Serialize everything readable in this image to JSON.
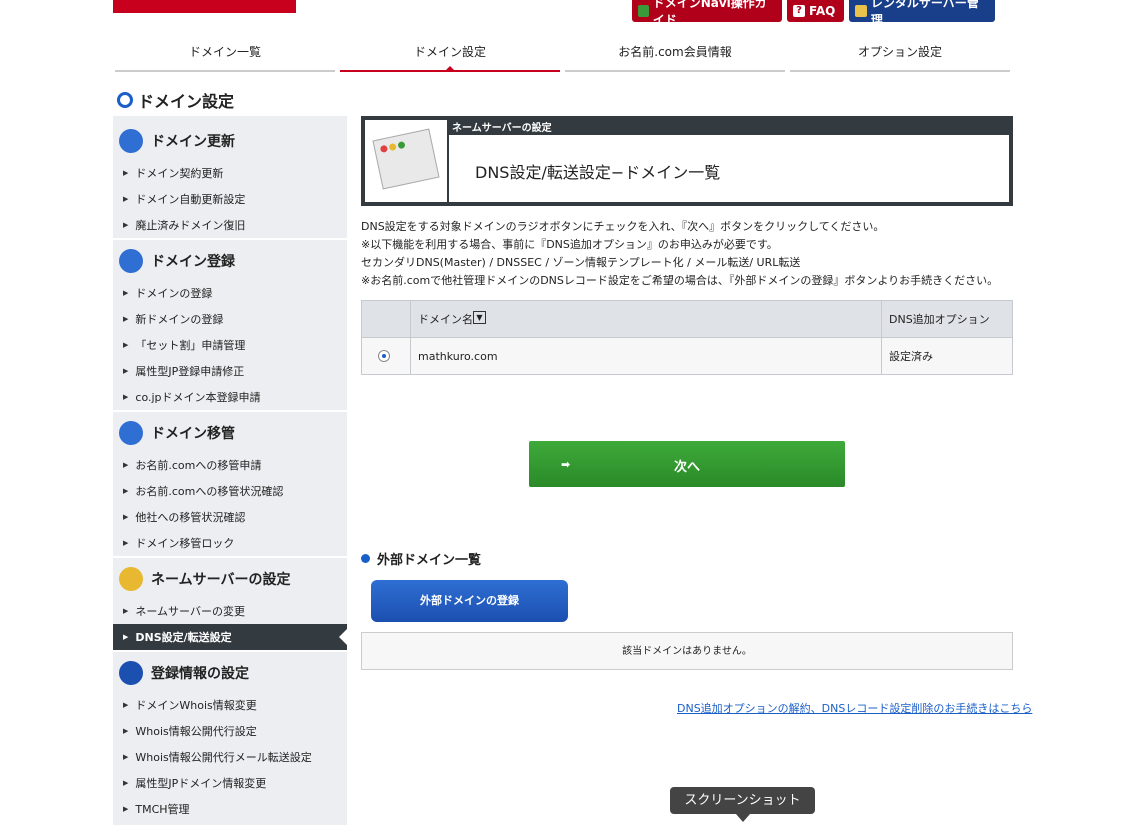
{
  "top_buttons": {
    "navi": "ドメインNavi操作ガイド",
    "faq": "FAQ",
    "rental": "レンタルサーバー管理"
  },
  "global_nav": {
    "items": [
      "ドメイン一覧",
      "ドメイン設定",
      "お名前.com会員情報",
      "オプション設定"
    ],
    "active_index": 1
  },
  "page_title": "ドメイン設定",
  "sidebar": {
    "sections": [
      {
        "title": "ドメイン更新",
        "items": [
          "ドメイン契約更新",
          "ドメイン自動更新設定",
          "廃止済みドメイン復旧"
        ]
      },
      {
        "title": "ドメイン登録",
        "items": [
          "ドメインの登録",
          "新ドメインの登録",
          "「セット割」申請管理",
          "属性型JP登録申請修正",
          "co.jpドメイン本登録申請"
        ]
      },
      {
        "title": "ドメイン移管",
        "items": [
          "お名前.comへの移管申請",
          "お名前.comへの移管状況確認",
          "他社への移管状況確認",
          "ドメイン移管ロック"
        ]
      },
      {
        "title": "ネームサーバーの設定",
        "items": [
          "ネームサーバーの変更",
          "DNS設定/転送設定"
        ]
      },
      {
        "title": "登録情報の設定",
        "items": [
          "ドメインWhois情報変更",
          "Whois情報公開代行設定",
          "Whois情報公開代行メール転送設定",
          "属性型JPドメイン情報変更",
          "TMCH管理"
        ]
      }
    ],
    "active_item": "DNS設定/転送設定"
  },
  "panel": {
    "small_label": "ネームサーバーの設定",
    "title": "DNS設定/転送設定−ドメイン一覧"
  },
  "description": [
    "DNS設定をする対象ドメインのラジオボタンにチェックを入れ、『次へ』ボタンをクリックしてください。",
    "※以下機能を利用する場合、事前に『DNS追加オプション』のお申込みが必要です。",
    "セカンダリDNS(Master) / DNSSEC / ゾーン情報テンプレート化 / メール転送/ URL転送",
    "※お名前.comで他社管理ドメインのDNSレコード設定をご希望の場合は、『外部ドメインの登録』ボタンよりお手続きください。"
  ],
  "table": {
    "headers": [
      "ドメイン名",
      "DNS追加オプション"
    ],
    "rows": [
      {
        "domain": "mathkuro.com",
        "option": "設定済み",
        "selected": true
      }
    ]
  },
  "next_button": "次へ",
  "external": {
    "title": "外部ドメイン一覧",
    "register_button": "外部ドメインの登録",
    "empty_message": "該当ドメインはありません。"
  },
  "cancel_link": "DNS追加オプションの解約、DNSレコード設定削除のお手続きはこちら",
  "tooltip": "スクリーンショット",
  "colors": {
    "brand_red": "#c8001e",
    "sidebar_bg": "#eceef1",
    "active_dark": "#333a40",
    "green": "#2f9a2d",
    "blue": "#1a5fc8"
  }
}
